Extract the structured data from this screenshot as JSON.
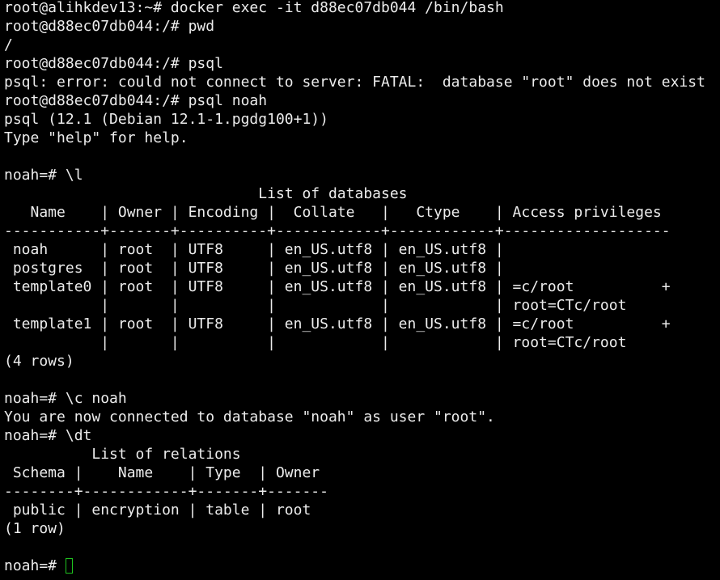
{
  "terminal": {
    "lines": [
      "root@alihkdev13:~# docker exec -it d88ec07db044 /bin/bash",
      "root@d88ec07db044:/# pwd",
      "/",
      "root@d88ec07db044:/# psql",
      "psql: error: could not connect to server: FATAL:  database \"root\" does not exist",
      "root@d88ec07db044:/# psql noah",
      "psql (12.1 (Debian 12.1-1.pgdg100+1))",
      "Type \"help\" for help.",
      "",
      "noah=# \\l",
      "                             List of databases",
      "   Name    | Owner | Encoding |  Collate   |   Ctype    | Access privileges",
      "-----------+-------+----------+------------+------------+-------------------",
      " noah      | root  | UTF8     | en_US.utf8 | en_US.utf8 | ",
      " postgres  | root  | UTF8     | en_US.utf8 | en_US.utf8 | ",
      " template0 | root  | UTF8     | en_US.utf8 | en_US.utf8 | =c/root          +",
      "           |       |          |            |            | root=CTc/root",
      " template1 | root  | UTF8     | en_US.utf8 | en_US.utf8 | =c/root          +",
      "           |       |          |            |            | root=CTc/root",
      "(4 rows)",
      "",
      "noah=# \\c noah",
      "You are now connected to database \"noah\" as user \"root\".",
      "noah=# \\dt",
      "          List of relations",
      " Schema |    Name    | Type  | Owner",
      "--------+------------+-------+-------",
      " public | encryption | table | root",
      "(1 row)",
      ""
    ],
    "prompt": "noah=# ",
    "cursor_color": "#1fc31f",
    "text_color": "#ececec",
    "background": "#000000"
  }
}
